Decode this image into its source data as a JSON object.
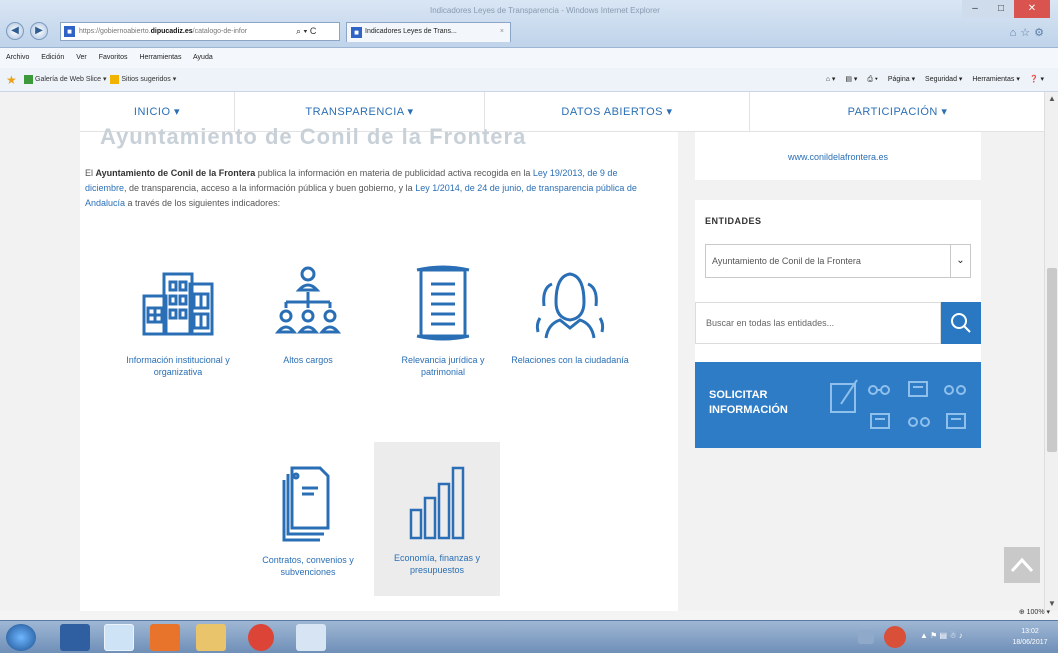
{
  "browser": {
    "address_url_prefix": "https://gobiernoabierto.",
    "address_url_domain": "dipucadiz.es",
    "address_url_suffix": "/catalogo-de-infor",
    "address_actions": "⌕ ▾ C",
    "tab_title": "Indicadores Leyes de Trans...",
    "tab_close": "×",
    "window_title": "Indicadores Leyes de Transparencia - Windows Internet Explorer",
    "menu": [
      "Archivo",
      "Edición",
      "Ver",
      "Favoritos",
      "Herramientas",
      "Ayuda"
    ],
    "favorites": [
      "Galería de Web Slice ▾",
      "Sitios sugeridos ▾"
    ],
    "command_bar": [
      "Página ▾",
      "Seguridad ▾",
      "Herramientas ▾"
    ],
    "zoom": "⊕ 100% ▾"
  },
  "site": {
    "nav": [
      "INICIO ▾",
      "TRANSPARENCIA ▾",
      "DATOS ABIERTOS ▾",
      "PARTICIPACIÓN ▾"
    ],
    "page_heading": "Ayuntamiento de Conil de la Frontera",
    "intro_bold": "Ayuntamiento de Conil de la Frontera",
    "intro_prefix": "El ",
    "intro_text_1": " publica la información en materia de publicidad activa recogida en la ",
    "intro_link_1": "Ley 19/2013, de 9 de diciembre",
    "intro_text_2": ", de transparencia, acceso a la información pública y buen gobierno, y la ",
    "intro_link_2": "Ley 1/2014, de 24 de junio, de transparencia pública de Andalucía",
    "intro_text_3": " a través de los siguientes indicadores:",
    "indicators": [
      {
        "label": "Información institucional y organizativa",
        "icon": "buildings-icon"
      },
      {
        "label": "Altos cargos",
        "icon": "org-chart-icon"
      },
      {
        "label": "Relevancia jurídica y patrimonial",
        "icon": "scroll-icon"
      },
      {
        "label": "Relaciones con la ciudadanía",
        "icon": "people-icon"
      },
      {
        "label": "Contratos, convenios y subvenciones",
        "icon": "documents-icon"
      },
      {
        "label": "Economía, finanzas y presupuestos",
        "icon": "bar-chart-icon"
      }
    ]
  },
  "sidebar": {
    "website_link": "www.conildelafrontera.es",
    "entities_title": "ENTIDADES",
    "entity_selected": "Ayuntamiento de Conil de la Frontera",
    "search_placeholder": "Buscar en todas las entidades...",
    "solicitar_line1": "SOLICITAR",
    "solicitar_line2": "INFORMACIÓN"
  },
  "taskbar": {
    "clock_time": "13:02",
    "clock_date": "18/06/2017"
  },
  "colors": {
    "accent": "#2a6fb5",
    "solicitar_bg": "#2f7cc6",
    "search_btn": "#2a78c2"
  }
}
